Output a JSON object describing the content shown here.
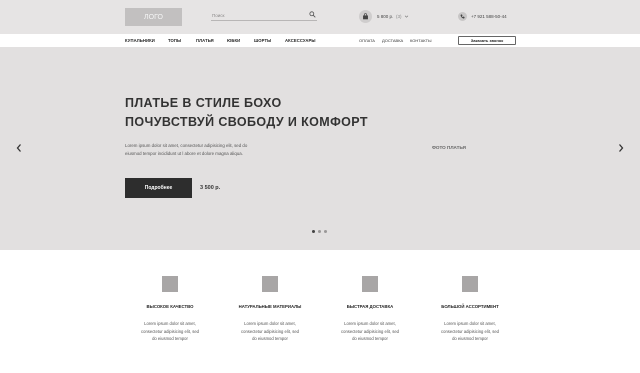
{
  "header": {
    "logo": "ЛОГО",
    "search_placeholder": "Поиск",
    "cart_sum": "5 800 р.",
    "cart_count": "(3)",
    "phone": "+7 921 588-50-44"
  },
  "nav": {
    "categories": [
      "КУПАЛЬНИКИ",
      "ТОПЫ",
      "ПЛАТЬЯ",
      "ЮБКИ",
      "ШОРТЫ",
      "АКСЕССУАРЫ"
    ],
    "secondary": [
      "ОПЛАТА",
      "ДОСТАВКА",
      "КОНТАКТЫ"
    ],
    "call_button": "Заказать звонок"
  },
  "hero": {
    "title_line1": "ПЛАТЬЕ В СТИЛЕ БОХО",
    "title_line2": "ПОЧУВСТВУЙ СВОБОДУ И КОМФОРТ",
    "description": "Lorem ipsum dolor sit amet, consectetur adipisicing elit, sed do eiusmod tempor incididunt ut l abore et dolore magna aliqua.",
    "button": "Подробнее",
    "price": "3 500 р.",
    "photo_label": "ФОТО ПЛАТЬЯ",
    "slides_total": 3,
    "active_slide": 1
  },
  "features": [
    {
      "title": "ВЫСОКОЕ КАЧЕСТВО",
      "text": "Lorem ipsum dolor sit amet, consectetur adipisicing elit, sed do eiusmod tempor"
    },
    {
      "title": "НАТУРАЛЬНЫЕ МАТЕРИАЛЫ",
      "text": "Lorem ipsum dolor sit amet, consectetur adipisicing elit, sed do eiusmod tempor"
    },
    {
      "title": "БЫСТРАЯ ДОСТАВКА",
      "text": "Lorem ipsum dolor sit amet, consectetur adipisicing elit, sed do eiusmod tempor"
    },
    {
      "title": "БОЛЬШОЙ АССОРТИМЕНТ",
      "text": "Lorem ipsum dolor sit amet, consectetur adipisicing elit, sed do eiusmod tempor"
    }
  ],
  "colors": {
    "header_bg": "#e6e4e4",
    "hero_bg": "#e2e0e0",
    "button_dark": "#2d2d2d",
    "placeholder_gray": "#a8a6a6"
  },
  "icons": [
    "search-icon",
    "cart-icon",
    "chevron-down-icon",
    "phone-icon",
    "arrow-left-icon",
    "arrow-right-icon"
  ]
}
